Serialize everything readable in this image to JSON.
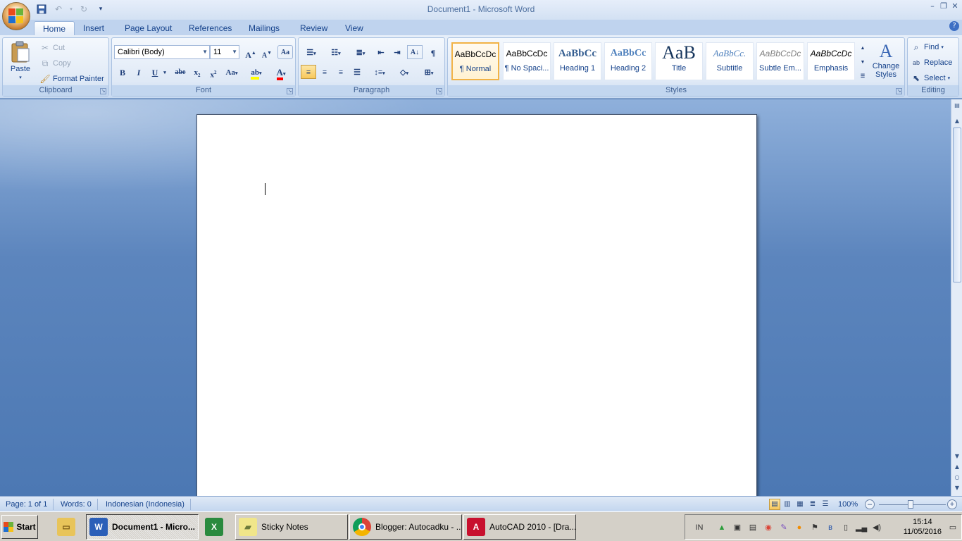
{
  "window": {
    "title": "Document1 - Microsoft Word"
  },
  "tabs": [
    {
      "label": "Home",
      "active": true
    },
    {
      "label": "Insert"
    },
    {
      "label": "Page Layout"
    },
    {
      "label": "References"
    },
    {
      "label": "Mailings"
    },
    {
      "label": "Review"
    },
    {
      "label": "View"
    }
  ],
  "clipboard": {
    "label": "Clipboard",
    "paste": "Paste",
    "cut": "Cut",
    "copy": "Copy",
    "format_painter": "Format Painter"
  },
  "font": {
    "label": "Font",
    "family": "Calibri (Body)",
    "size": "11",
    "text_highlight_color": "#ffff00",
    "font_color": "#ff0000"
  },
  "paragraph": {
    "label": "Paragraph"
  },
  "styles": {
    "label": "Styles",
    "items": [
      {
        "sample": "AaBbCcDc",
        "name": "¶ Normal",
        "selected": true
      },
      {
        "sample": "AaBbCcDc",
        "name": "¶ No Spaci..."
      },
      {
        "sample": "AaBbCc",
        "name": "Heading 1"
      },
      {
        "sample": "AaBbCc",
        "name": "Heading 2"
      },
      {
        "sample": "AaB",
        "name": "Title"
      },
      {
        "sample": "AaBbCc.",
        "name": "Subtitle"
      },
      {
        "sample": "AaBbCcDc",
        "name": "Subtle Em..."
      },
      {
        "sample": "AaBbCcDc",
        "name": "Emphasis"
      }
    ],
    "change_styles": "Change Styles"
  },
  "editing": {
    "label": "Editing",
    "find": "Find",
    "replace": "Replace",
    "select": "Select"
  },
  "status": {
    "page": "Page: 1 of 1",
    "words": "Words: 0",
    "language": "Indonesian (Indonesia)",
    "zoom": "100%"
  },
  "taskbar": {
    "start": "Start",
    "buttons": [
      {
        "label": "Document1 - Micro...",
        "active": true
      },
      {
        "label": "Sticky Notes"
      },
      {
        "label": "Blogger: Autocadku - ..."
      },
      {
        "label": "AutoCAD 2010 - [Dra..."
      }
    ],
    "tray_lang": "IN",
    "time": "15:14",
    "date": "11/05/2016"
  }
}
